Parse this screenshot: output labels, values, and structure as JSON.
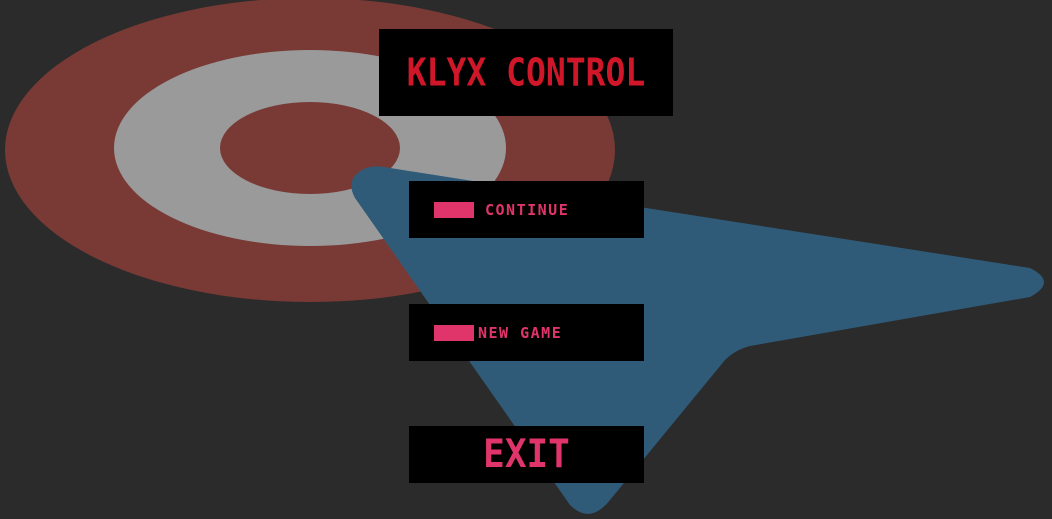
{
  "title": "KLYX CONTROL",
  "menu": {
    "continue_label": "CONTINUE",
    "new_game_label": "NEW GAME",
    "exit_label": "EXIT"
  },
  "colors": {
    "background": "#2b2b2b",
    "target_outer": "#793a35",
    "target_middle": "#9a9a9a",
    "target_inner": "#793a35",
    "arrow": "#2f5b78",
    "panel": "#000000",
    "title_text": "#d0172a",
    "button_text": "#e0356b"
  },
  "icons": {
    "target": "target-rings-icon",
    "cursor": "arrow-cursor-icon",
    "button_marker": "menu-marker-icon"
  }
}
